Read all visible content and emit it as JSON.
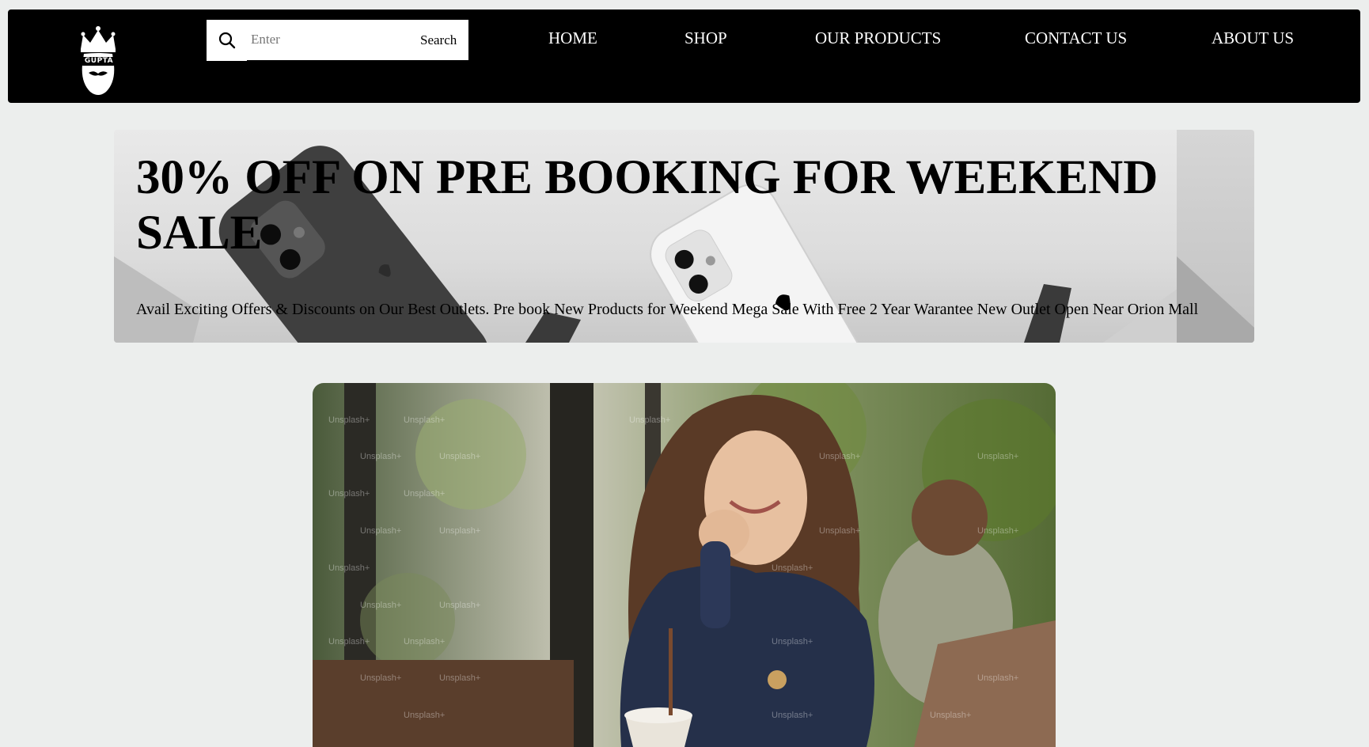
{
  "header": {
    "logo_text": "GUPTA",
    "search": {
      "placeholder": "Enter",
      "button_label": "Search"
    },
    "nav": [
      {
        "label": "HOME"
      },
      {
        "label": "SHOP"
      },
      {
        "label": "OUR PRODUCTS"
      },
      {
        "label": "CONTACT US"
      },
      {
        "label": "ABOUT US"
      }
    ]
  },
  "banner": {
    "title": "30% OFF ON PRE BOOKING FOR WEEKEND SALE",
    "text": "Avail Exciting Offers & Discounts on Our Best Outlets. Pre book New Products for Weekend Mega Sale With Free 2 Year Warantee New Outlet Open Near Orion Mall"
  },
  "hero": {
    "watermark": "Unsplash+"
  },
  "colors": {
    "navbar_bg": "#000000",
    "page_bg": "#eceeed",
    "nav_text": "#ffffff"
  }
}
